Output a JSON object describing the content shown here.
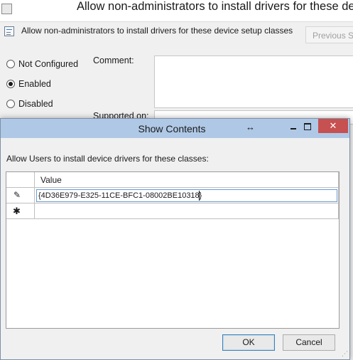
{
  "background_window": {
    "title": "Allow non-administrators to install drivers for these device s",
    "policy_name": "Allow non-administrators to install drivers for these device setup classes",
    "previous_button": "Previous Se",
    "radios": [
      {
        "label": "Not Configured",
        "selected": false
      },
      {
        "label": "Enabled",
        "selected": true
      },
      {
        "label": "Disabled",
        "selected": false
      }
    ],
    "comment_label": "Comment:",
    "supported_label": "Supported on:"
  },
  "dialog": {
    "title": "Show Contents",
    "instruction": "Allow Users to install device drivers for these classes:",
    "table": {
      "column_header": "Value",
      "rows": [
        {
          "value": "{4D36E979-E325-11CE-BFC1-08002BE10318}",
          "state": "editing"
        },
        {
          "value": "",
          "state": "new"
        }
      ]
    },
    "ok_button": "OK",
    "cancel_button": "Cancel",
    "close_glyph": "✕",
    "resize_glyph": "↔",
    "edit_glyph": "✎",
    "new_row_glyph": "✱"
  },
  "colors": {
    "dialog_title_bg": "#afc8e6",
    "close_button_bg": "#c75050",
    "input_border": "#6c9bd2"
  }
}
